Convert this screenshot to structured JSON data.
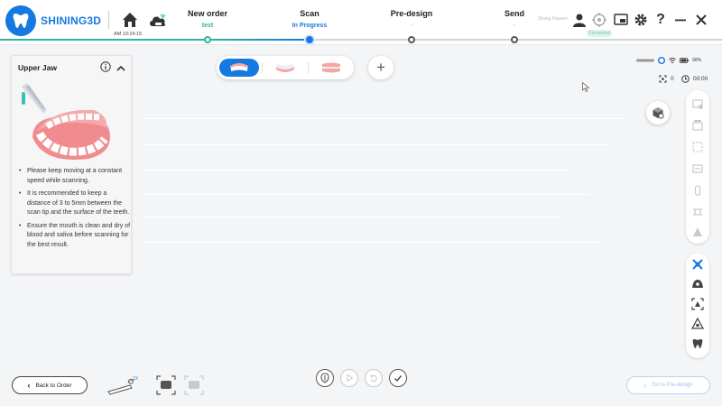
{
  "app": {
    "brand": "SHINING3D"
  },
  "header": {
    "time": "AM 10:24:15",
    "user_name": "Shang Hausen",
    "connection_status": "Connected",
    "steps": [
      {
        "title": "New order",
        "sub": "test"
      },
      {
        "title": "Scan",
        "sub": "In Progress"
      },
      {
        "title": "Pre-design",
        "sub": "-"
      },
      {
        "title": "Send",
        "sub": "-"
      }
    ]
  },
  "guide": {
    "title": "Upper Jaw",
    "tips": [
      "Please keep moving at a constant speed while scanning.",
      "It is recommended to keep a distance of 3 to 5mm between the scan tip and the surface of the teeth.",
      "Ensure the mouth is clean and dry of blood and saliva before scanning for the best result."
    ]
  },
  "jaw_selector": {
    "selected": "upper-jaw",
    "add_label": "+"
  },
  "status": {
    "battery": "90%",
    "frame_count": "0",
    "elapsed": "00:00"
  },
  "bottom": {
    "back_label": "Back to Order",
    "scanner_zoom": "1X",
    "next_label": "Go to Pre-design"
  },
  "colors": {
    "accent": "#1479e0",
    "done": "#2bb5a3",
    "background": "#f4f5f7"
  }
}
